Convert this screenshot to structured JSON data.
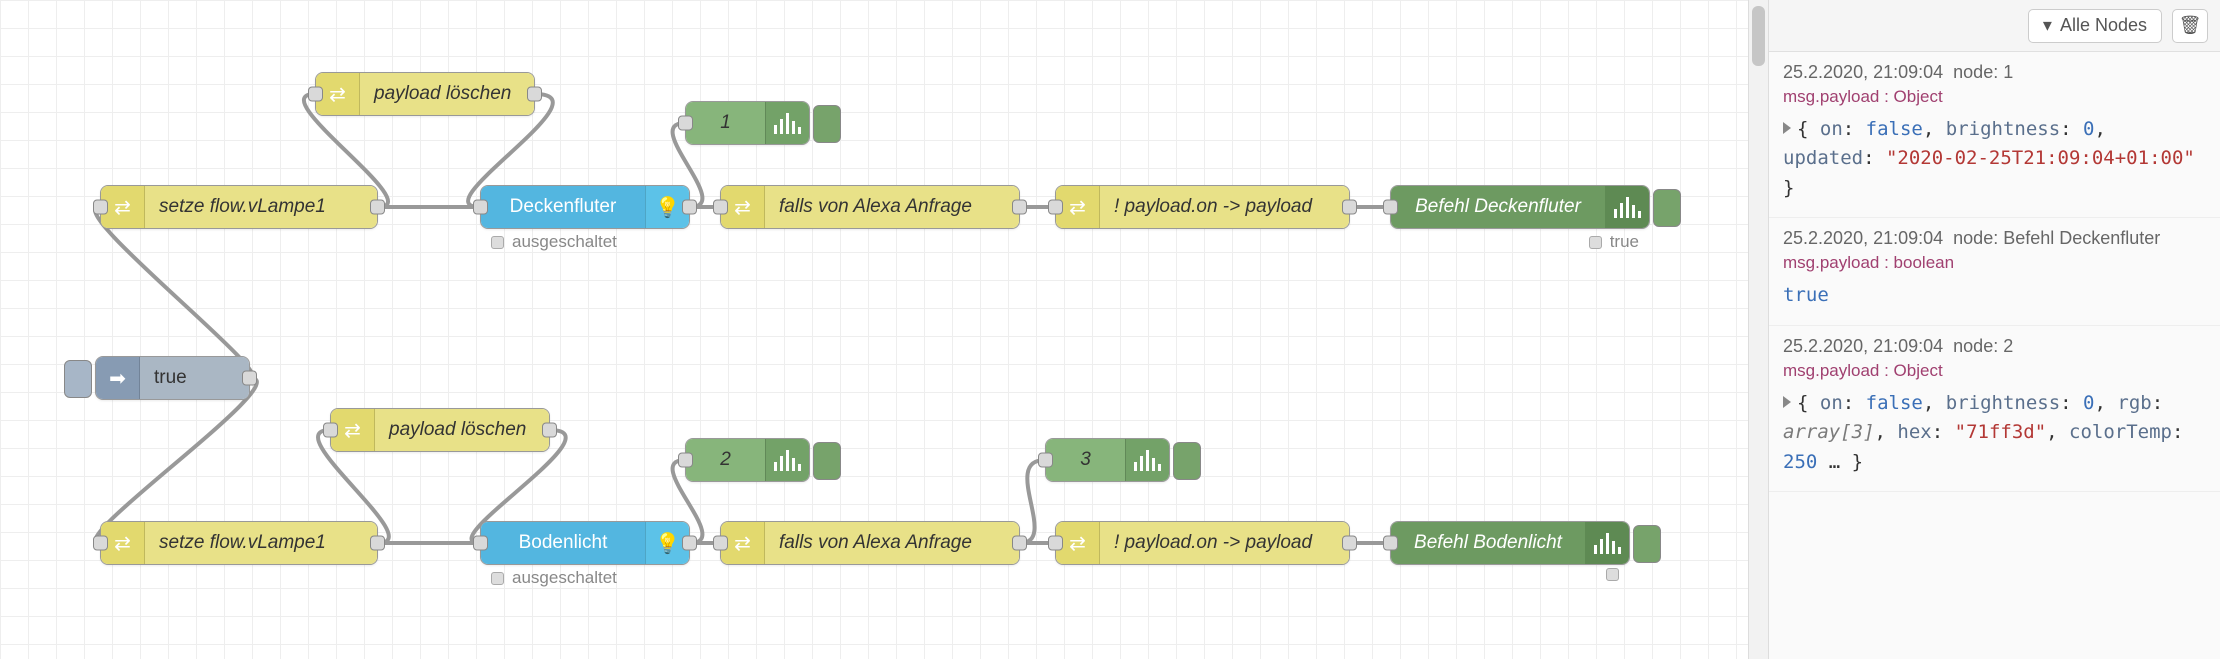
{
  "sidebar": {
    "filter_label": "Alle Nodes"
  },
  "nodes": {
    "inject": {
      "label": "true"
    },
    "setLampe1a": {
      "label": "setze flow.vLampe1"
    },
    "setLampe1b": {
      "label": "setze flow.vLampe1"
    },
    "payloadDel1": {
      "label": "payload löschen"
    },
    "payloadDel2": {
      "label": "payload löschen"
    },
    "decken": {
      "label": "Deckenfluter",
      "status": "ausgeschaltet"
    },
    "boden": {
      "label": "Bodenlicht",
      "status": "ausgeschaltet"
    },
    "alexa1": {
      "label": "falls von Alexa Anfrage"
    },
    "alexa2": {
      "label": "falls von Alexa Anfrage"
    },
    "neg1": {
      "label": "! payload.on -> payload"
    },
    "neg2": {
      "label": "! payload.on -> payload"
    },
    "befehl1": {
      "label": "Befehl Deckenfluter",
      "status": "true"
    },
    "befehl2": {
      "label": "Befehl Bodenlicht"
    },
    "dbg1": {
      "label": "1"
    },
    "dbg2": {
      "label": "2"
    },
    "dbg3": {
      "label": "3"
    }
  },
  "debug": [
    {
      "time": "25.2.2020, 21:09:04",
      "node": "node: 1",
      "type_line": "msg.payload : Object",
      "body_html": "{ <span class='k-key'>on</span>: <span class='k-bool'>false</span>, <span class='k-key'>brightness</span>: <span class='k-num'>0</span>, <span class='k-key'>updated</span>: <span class='k-str'>\"2020-02-25T21:09:04+01:00\"</span> }",
      "collapsible": true
    },
    {
      "time": "25.2.2020, 21:09:04",
      "node": "node: Befehl Deckenfluter",
      "type_line": "msg.payload : boolean",
      "body_html": "<span class='true-lone'>true</span>",
      "collapsible": false
    },
    {
      "time": "25.2.2020, 21:09:04",
      "node": "node: 2",
      "type_line": "msg.payload : Object",
      "body_html": "{ <span class='k-key'>on</span>: <span class='k-bool'>false</span>, <span class='k-key'>brightness</span>: <span class='k-num'>0</span>, <span class='k-key'>rgb</span>: <span class='k-type'>array[3]</span>, <span class='k-key'>hex</span>: <span class='k-str'>\"71ff3d\"</span>, <span class='k-key'>colorTemp</span>: <span class='k-num'>250</span> … }",
      "collapsible": true
    }
  ]
}
